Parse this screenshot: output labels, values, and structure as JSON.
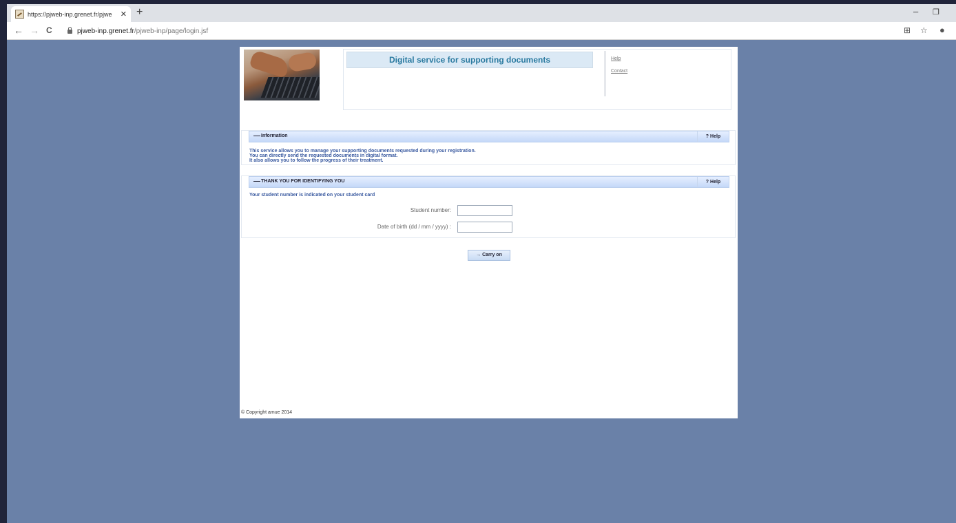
{
  "browser": {
    "tab_title": "https://pjweb-inp.grenet.fr/pjwe",
    "tab_close": "✕",
    "new_tab": "+",
    "url_host": "pjweb-inp.grenet.fr",
    "url_path": "/pjweb-inp/page/login.jsf",
    "minimize": "–",
    "restore": "❐",
    "back": "←",
    "forward": "→",
    "reload": "C",
    "translate": "⊞",
    "star": "☆",
    "profile": "●"
  },
  "header": {
    "title": "Digital service for supporting documents",
    "links": [
      "Help",
      "Contact"
    ]
  },
  "information": {
    "toggle": "—",
    "title": "Information",
    "help": "? Help",
    "lines": [
      "This service allows you to manage your supporting documents requested during your registration.",
      "You can directly send the requested documents in digital format.",
      "It also allows you to follow the progress of their treatment."
    ]
  },
  "identify": {
    "toggle": "—",
    "title": "THANK YOU FOR IDENTIFYING YOU",
    "help": "? Help",
    "hint": "Your student number is indicated on your student card",
    "student_number_label": "Student number:",
    "student_number_value": "",
    "dob_label": "Date of birth (dd / mm / yyyy) :",
    "dob_value": ""
  },
  "actions": {
    "carry_on": "→ Carry on"
  },
  "footer": {
    "copyright": "© Copyright amue 2014"
  }
}
